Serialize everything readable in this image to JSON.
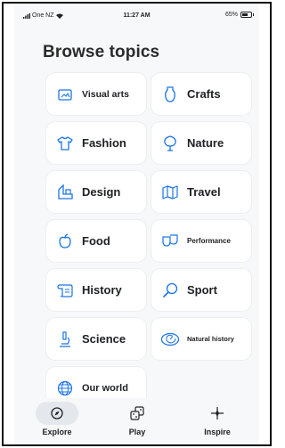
{
  "status_bar": {
    "carrier": "One NZ",
    "time": "11:27 AM",
    "battery": "65%"
  },
  "page": {
    "title": "Browse topics"
  },
  "topics": [
    {
      "label": "Visual arts",
      "icon": "easel-icon"
    },
    {
      "label": "Crafts",
      "icon": "vase-icon"
    },
    {
      "label": "Fashion",
      "icon": "shirt-icon"
    },
    {
      "label": "Nature",
      "icon": "tree-icon"
    },
    {
      "label": "Design",
      "icon": "design-tools-icon"
    },
    {
      "label": "Travel",
      "icon": "map-icon"
    },
    {
      "label": "Food",
      "icon": "apple-icon"
    },
    {
      "label": "Performance",
      "icon": "theater-masks-icon"
    },
    {
      "label": "History",
      "icon": "scroll-icon"
    },
    {
      "label": "Sport",
      "icon": "sport-icon"
    },
    {
      "label": "Science",
      "icon": "microscope-icon"
    },
    {
      "label": "Natural history",
      "icon": "fossil-icon"
    },
    {
      "label": "Our world",
      "icon": "globe-icon"
    }
  ],
  "bottom_nav": [
    {
      "label": "Explore",
      "icon": "compass-icon",
      "active": true
    },
    {
      "label": "Play",
      "icon": "dice-icon",
      "active": false
    },
    {
      "label": "Inspire",
      "icon": "sparkle-icon",
      "active": false
    }
  ],
  "colors": {
    "background": "#f7f8fa",
    "tile": "#ffffff",
    "icon_accent": "#1a73e8",
    "active_pill": "#e4e7eb"
  }
}
